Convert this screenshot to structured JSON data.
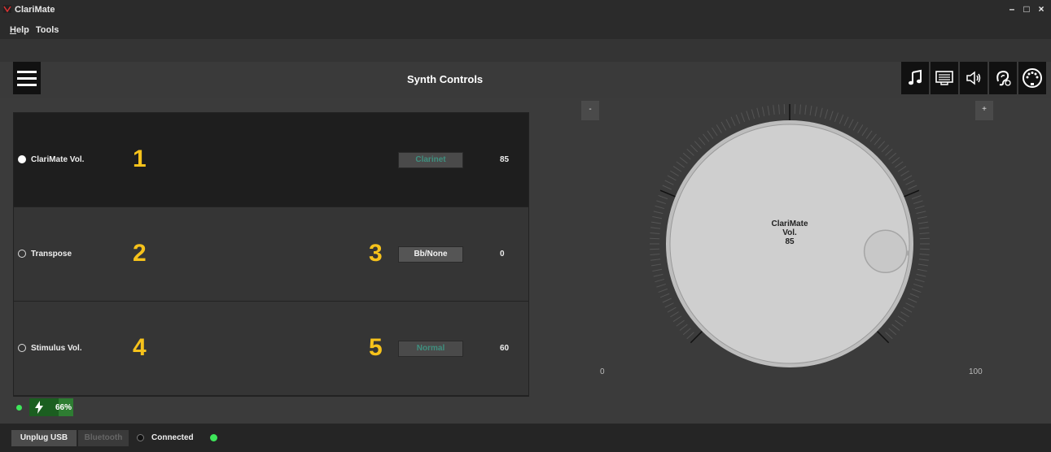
{
  "window": {
    "title": "ClariMate",
    "controls": [
      "–",
      "□",
      "×"
    ]
  },
  "menu": {
    "items": [
      {
        "label": "Help",
        "accel": "H",
        "rest": "elp"
      },
      {
        "label": "Tools"
      }
    ]
  },
  "header": {
    "title": "Synth Controls",
    "toolbar_icons": [
      "music-note-icon",
      "keyboard-display-icon",
      "speaker-icon",
      "ear-icon",
      "midi-connector-icon"
    ]
  },
  "rows": [
    {
      "label": "ClariMate Vol.",
      "number": "1",
      "mode": "Clarinet",
      "mode_number": "",
      "value": "85",
      "selected": true
    },
    {
      "label": "Transpose",
      "number": "2",
      "mode": "Bb/None",
      "mode_number": "3",
      "value": "0",
      "selected": false
    },
    {
      "label": "Stimulus Vol.",
      "number": "4",
      "mode": "Normal",
      "mode_number": "5",
      "value": "60",
      "selected": false
    }
  ],
  "battery": {
    "percent_label": "66%",
    "level": 0.66
  },
  "bottom": {
    "unplug_label": "Unplug USB",
    "bluetooth_label": "Bluetooth",
    "connected_label": "Connected"
  },
  "knob": {
    "minus_label": "-",
    "plus_label": "+",
    "min_label": "0",
    "max_label": "100",
    "line1": "ClariMate",
    "line2": "Vol.",
    "line3": "85",
    "value": 85,
    "min": 0,
    "max": 100
  },
  "colors": {
    "accent_number": "#f6c21b",
    "status_green": "#3ee65a",
    "battery_green": "#2e7d32"
  }
}
